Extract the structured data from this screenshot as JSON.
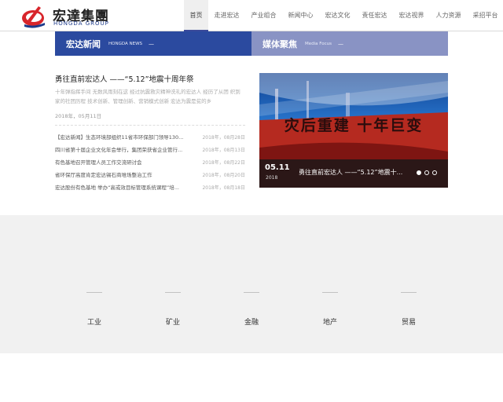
{
  "header": {
    "logo_cn": "宏達集團",
    "logo_en": "HONGDA GROUP",
    "nav": [
      "首页",
      "走进宏达",
      "产业组合",
      "新闻中心",
      "宏达文化",
      "责任宏达",
      "宏达视界",
      "人力资源",
      "采招平台"
    ]
  },
  "section_tabs": {
    "news": {
      "title": "宏达新闻",
      "sub": "HONGDA NEWS",
      "dash": "—"
    },
    "media": {
      "title": "媒体聚焦",
      "sub": "Media Focus",
      "dash": "—"
    }
  },
  "news": {
    "headline": "勇往直前宏达人 ——“5.12”地震十周年祭",
    "summary": "十年弹指挥手间 无数风雨刻在这 经过抗震救灾精神洗礼的宏达人 经历了从团 织到家的社团历程 技术创新、管理创新、营销模式创新 宏达为震是贫的乡",
    "summary_date": "2018年，05月11日",
    "items": [
      {
        "title": "【宏达新闻】生态环境部组织11省市环保部门领导130...",
        "date": "2018年，08月28日"
      },
      {
        "title": "四川省第十届企业文化年会举行，集团荣获省企业管行...",
        "date": "2018年，08月13日"
      },
      {
        "title": "有色基地召开管理人员工作交流研讨会",
        "date": "2018年，08月22日"
      },
      {
        "title": "省环保厅高度肯定宏达锡石商堆场整治工作",
        "date": "2018年，08月20日"
      },
      {
        "title": "宏达股份有色基地 举办“高或效目标管理系统课程”培...",
        "date": "2018年，08月18日"
      }
    ]
  },
  "feature": {
    "date": "05.11",
    "year": "2018",
    "title": "勇往直前宏达人 ——“5.12”地震十...",
    "caption": "灾后重建 十年巨变",
    "dots_total": 3,
    "active_dot": 1,
    "colors": {
      "sky": "#1d5fb8",
      "red": "#a8201f"
    }
  },
  "industry": {
    "items": [
      "工业",
      "矿业",
      "金融",
      "地产",
      "贸易"
    ]
  }
}
